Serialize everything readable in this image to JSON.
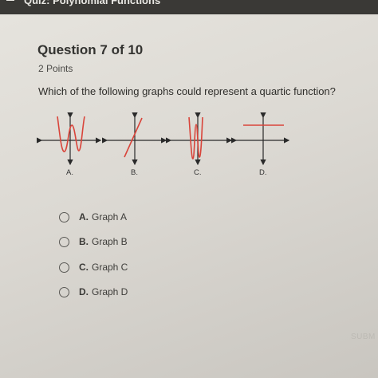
{
  "header": {
    "title": "Quiz: Polynomial Functions",
    "menu_icon": "back-arrow-icon"
  },
  "question": {
    "title": "Question 7 of 10",
    "points": "2 Points",
    "text": "Which of the following graphs could represent a quartic function?"
  },
  "graphs": [
    {
      "label": "A."
    },
    {
      "label": "B."
    },
    {
      "label": "C."
    },
    {
      "label": "D."
    }
  ],
  "options": [
    {
      "letter": "A.",
      "text": "Graph A"
    },
    {
      "letter": "B.",
      "text": "Graph B"
    },
    {
      "letter": "C.",
      "text": "Graph C"
    },
    {
      "letter": "D.",
      "text": "Graph D"
    }
  ],
  "footer": {
    "submit_label": "SUBM"
  },
  "colors": {
    "curve": "#d9443a",
    "axis": "#2a2a2a",
    "text": "#333330"
  }
}
